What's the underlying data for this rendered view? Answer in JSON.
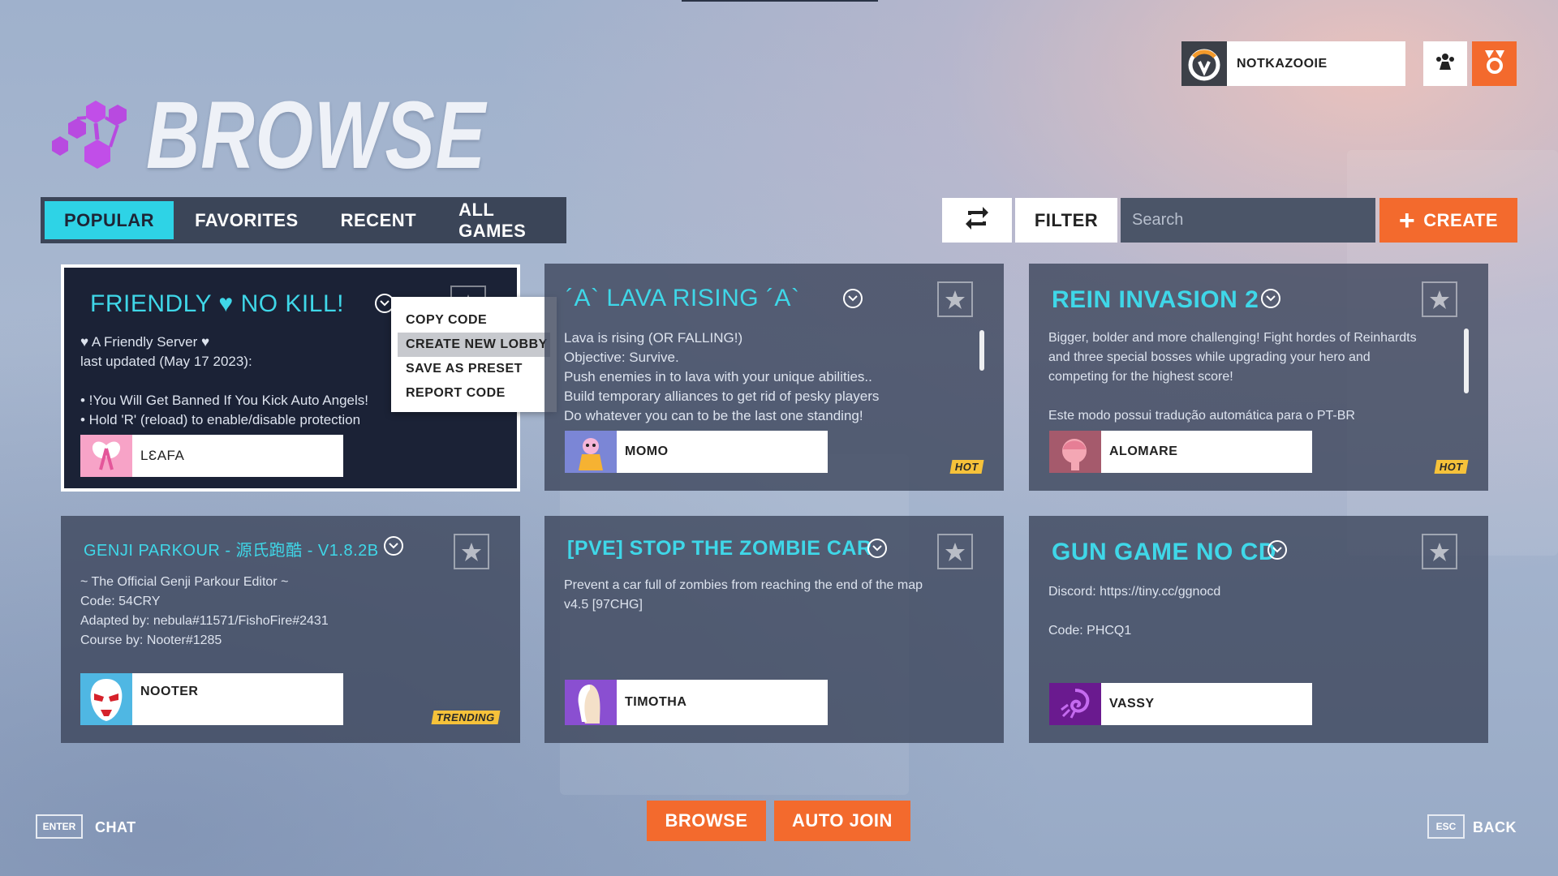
{
  "user": {
    "name": "NOTKAZOOIE",
    "emblem_icon": "overwatch-logo-icon",
    "social_icon": "group-icon",
    "reward_icon": "rewards-icon"
  },
  "page": {
    "title": "BROWSE"
  },
  "tabs": [
    {
      "label": "POPULAR",
      "active": true
    },
    {
      "label": "FAVORITES",
      "active": false
    },
    {
      "label": "RECENT",
      "active": false
    },
    {
      "label": "ALL GAMES",
      "active": false
    }
  ],
  "toolbar": {
    "filter_label": "FILTER",
    "search_placeholder": "Search",
    "create_label": "CREATE"
  },
  "cards": [
    {
      "title": "FRIENDLY ♥ NO KILL!",
      "description": "♥ A Friendly Server ♥\nlast updated (May 17 2023):\n\n• !You Will Get Banned If You Kick Auto Angels!\n• Hold 'R' (reload) to enable/disable protection",
      "author": "LƐAFA",
      "badge": ""
    },
    {
      "title": "´A` LAVA RISING ´A`",
      "description": "Lava is rising (OR FALLING!)\nObjective: Survive.\nPush enemies in to lava with your unique abilities..\nBuild temporary alliances to get rid of pesky players\nDo whatever you can to be the last one standing!",
      "author": "MOMO",
      "badge": "HOT"
    },
    {
      "title": "REIN INVASION 2",
      "description": "Bigger, bolder and more challenging! Fight hordes of Reinhardts\nand three special bosses while upgrading your hero and\ncompeting for the highest score!\n\nEste modo possui tradução automática para o PT-BR",
      "author": "ALOMARE",
      "badge": "HOT"
    },
    {
      "title": "GENJI PARKOUR - 源氏跑酷 - V1.8.2B",
      "description": "~ The Official Genji Parkour Editor ~\nCode: 54CRY\nAdapted by: nebula#11571/FishoFire#2431\nCourse by: Nooter#1285",
      "author": "NOOTER",
      "badge": "TRENDING"
    },
    {
      "title": "[PVE] STOP THE ZOMBIE CAR",
      "description": "Prevent a car full of zombies from reaching the end of the map\nv4.5 [97CHG]",
      "author": "TIMOTHA",
      "badge": ""
    },
    {
      "title": "GUN GAME NO CD",
      "description": "Discord: https://tiny.cc/ggnocd\n\nCode: PHCQ1",
      "author": "VASSY",
      "badge": ""
    }
  ],
  "context_menu": {
    "items": [
      "COPY CODE",
      "CREATE NEW LOBBY",
      "SAVE AS PRESET",
      "REPORT CODE"
    ],
    "highlighted": "CREATE NEW LOBBY"
  },
  "footer": {
    "chat_key": "ENTER",
    "chat_label": "CHAT",
    "browse_label": "BROWSE",
    "autojoin_label": "AUTO JOIN",
    "back_key": "ESC",
    "back_label": "BACK"
  },
  "colors": {
    "accent_cyan": "#2ed3e6",
    "accent_orange": "#f36a2d",
    "badge_yellow": "#f6c23a",
    "logo_purple": "#b84ae0"
  }
}
